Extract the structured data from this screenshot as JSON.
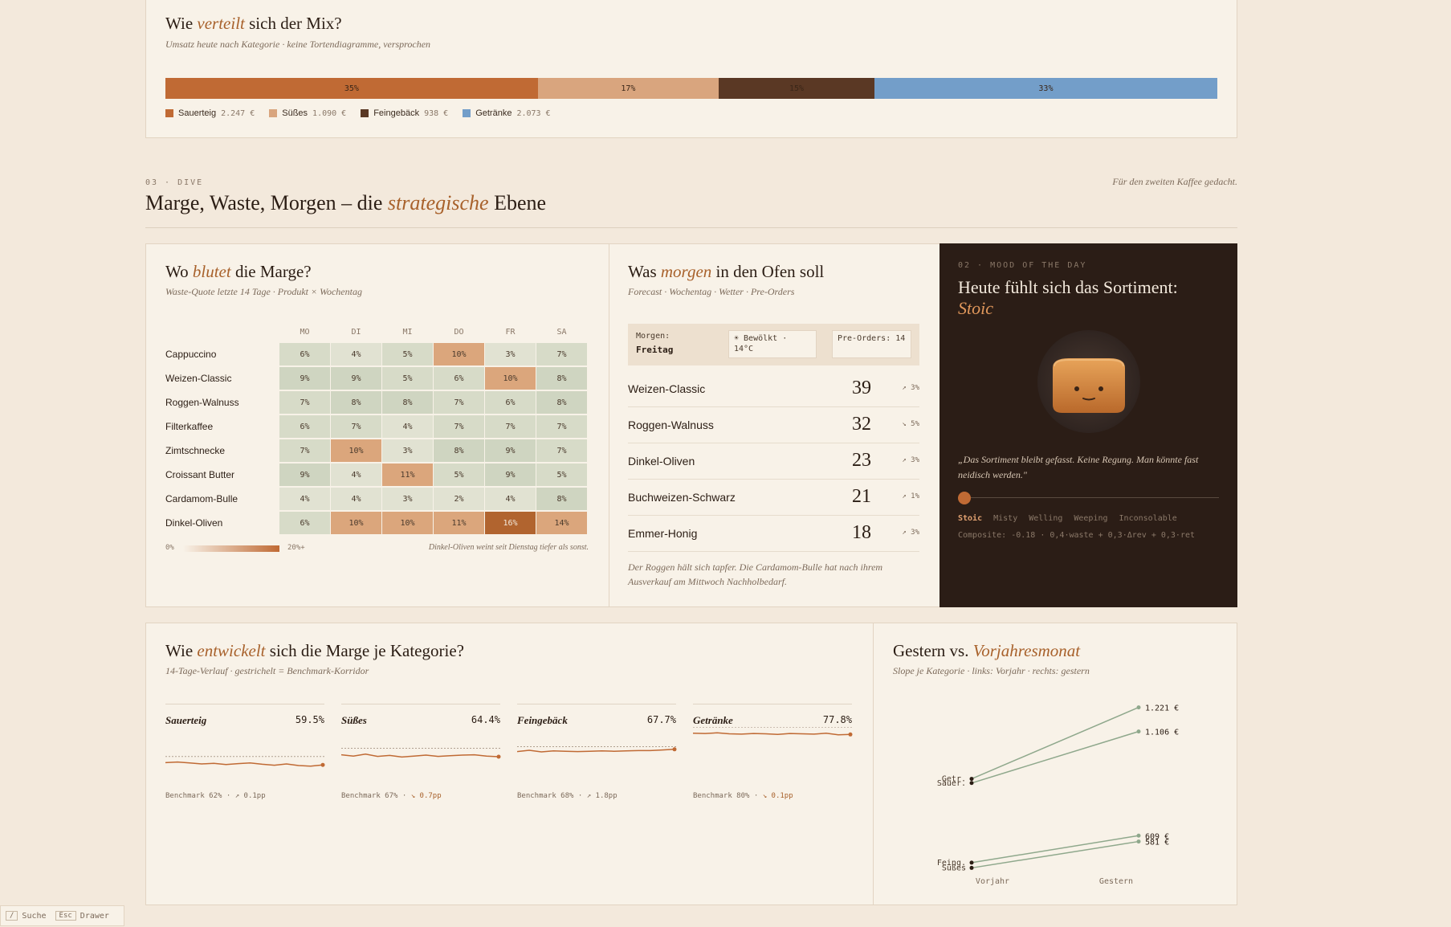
{
  "mix": {
    "title_pre": "Wie ",
    "title_em": "verteilt",
    "title_post": " sich der Mix?",
    "subtitle": "Umsatz heute nach Kategorie · keine Tortendiagramme, versprochen",
    "segments": [
      {
        "label": "35%",
        "share": 35.4,
        "color": "#c06a34"
      },
      {
        "label": "17%",
        "share": 17.2,
        "color": "#d9a57e"
      },
      {
        "label": "15%",
        "share": 14.8,
        "color": "#5a3824"
      },
      {
        "label": "33%",
        "share": 32.6,
        "color": "#739ec9"
      }
    ],
    "legend": [
      {
        "name": "Sauerteig",
        "value": "2.247 €",
        "color": "#c06a34"
      },
      {
        "name": "Süßes",
        "value": "1.090 €",
        "color": "#d9a57e"
      },
      {
        "name": "Feingebäck",
        "value": "938 €",
        "color": "#5a3824"
      },
      {
        "name": "Getränke",
        "value": "2.073 €",
        "color": "#739ec9"
      }
    ]
  },
  "section": {
    "eyebrow": "03 · DIVE",
    "title_pre": "Marge, Waste, Morgen – die ",
    "title_em": "strategische",
    "title_post": " Ebene",
    "aside": "Für den zweiten Kaffee gedacht."
  },
  "waste": {
    "title_pre": "Wo ",
    "title_em": "blutet",
    "title_post": " die Marge?",
    "subtitle": "Waste-Quote letzte 14 Tage · Produkt × Wochentag",
    "days": [
      "MO",
      "DI",
      "MI",
      "DO",
      "FR",
      "SA"
    ],
    "rows": [
      {
        "name": "Cappuccino",
        "values": [
          6,
          4,
          5,
          10,
          3,
          7
        ]
      },
      {
        "name": "Weizen-Classic",
        "values": [
          9,
          9,
          5,
          6,
          10,
          8
        ]
      },
      {
        "name": "Roggen-Walnuss",
        "values": [
          7,
          8,
          8,
          7,
          6,
          8
        ]
      },
      {
        "name": "Filterkaffee",
        "values": [
          6,
          7,
          4,
          7,
          7,
          7
        ]
      },
      {
        "name": "Zimtschnecke",
        "values": [
          7,
          10,
          3,
          8,
          9,
          7
        ]
      },
      {
        "name": "Croissant Butter",
        "values": [
          9,
          4,
          11,
          5,
          9,
          5
        ]
      },
      {
        "name": "Cardamom-Bulle",
        "values": [
          4,
          4,
          3,
          2,
          4,
          8
        ]
      },
      {
        "name": "Dinkel-Oliven",
        "values": [
          6,
          10,
          10,
          11,
          16,
          14
        ]
      }
    ],
    "scale_min": "0%",
    "scale_max": "20%+",
    "note": "Dinkel-Oliven weint seit Dienstag tiefer als sonst."
  },
  "forecast": {
    "title_pre": "Was ",
    "title_em": "morgen",
    "title_post": " in den Ofen soll",
    "subtitle": "Forecast · Wochentag · Wetter · Pre-Orders",
    "tomorrow_label": "Morgen:",
    "tomorrow_day": "Freitag",
    "weather": "☀ Bewölkt · 14°C",
    "preorders": "Pre-Orders: 14",
    "items": [
      {
        "name": "Weizen-Classic",
        "qty": "39",
        "trend": "↗ 3%"
      },
      {
        "name": "Roggen-Walnuss",
        "qty": "32",
        "trend": "↘ 5%"
      },
      {
        "name": "Dinkel-Oliven",
        "qty": "23",
        "trend": "↗ 3%"
      },
      {
        "name": "Buchweizen-Schwarz",
        "qty": "21",
        "trend": "↗ 1%"
      },
      {
        "name": "Emmer-Honig",
        "qty": "18",
        "trend": "↗ 3%"
      }
    ],
    "note": "Der Roggen hält sich tapfer. Die Cardamom-Bulle hat nach ihrem Ausverkauf am Mittwoch Nachholbedarf."
  },
  "mood": {
    "eyebrow": "02 · MOOD OF THE DAY",
    "title": "Heute fühlt sich das Sortiment:",
    "mood": "Stoic",
    "quote": "„Das Sortiment bleibt gefasst. Keine Regung. Man könnte fast neidisch werden.\"",
    "slider_level": 0.0,
    "scale": [
      "Stoic",
      "Misty",
      "Welling",
      "Weeping",
      "Inconsolable"
    ],
    "composite": "Composite: -0.18 · 0,4·waste + 0,3·Δrev + 0,3·ret"
  },
  "margin": {
    "title_pre": "Wie ",
    "title_em": "entwickelt",
    "title_post": " sich die Marge je Kategorie?",
    "subtitle": "14-Tage-Verlauf · gestrichelt = Benchmark-Korridor",
    "cats": [
      {
        "name": "Sauerteig",
        "value": "59.5%",
        "bench": "Benchmark 62% ·",
        "delta": "↗ 0.1pp",
        "dir": "up",
        "series": [
          60.2,
          60.4,
          60.1,
          59.8,
          60.0,
          59.6,
          59.9,
          60.1,
          59.7,
          59.4,
          59.8,
          59.3,
          59.1,
          59.5
        ],
        "benchmark": 62
      },
      {
        "name": "Süßes",
        "value": "64.4%",
        "bench": "Benchmark 67% ·",
        "delta": "↘ 0.7pp",
        "dir": "down",
        "series": [
          65.0,
          64.6,
          65.2,
          64.5,
          64.8,
          64.3,
          64.6,
          64.9,
          64.5,
          64.7,
          64.9,
          65.0,
          64.6,
          64.4
        ],
        "benchmark": 67
      },
      {
        "name": "Feingebäck",
        "value": "67.7%",
        "bench": "Benchmark 68% ·",
        "delta": "↗ 1.8pp",
        "dir": "up",
        "series": [
          67.0,
          67.4,
          66.9,
          67.2,
          67.1,
          67.0,
          67.1,
          67.2,
          67.1,
          67.2,
          67.3,
          67.3,
          67.5,
          67.7
        ],
        "benchmark": 68
      },
      {
        "name": "Getränke",
        "value": "77.8%",
        "bench": "Benchmark 80% ·",
        "delta": "↘ 0.1pp",
        "dir": "down",
        "series": [
          78.2,
          78.1,
          78.3,
          78.0,
          77.9,
          78.1,
          78.0,
          77.8,
          78.1,
          78.0,
          77.9,
          78.2,
          77.7,
          77.8
        ],
        "benchmark": 80
      }
    ]
  },
  "slope": {
    "title_pre": "Gestern vs. ",
    "title_em": "Vorjahresmonat",
    "subtitle": "Slope je Kategorie · links: Vorjahr · rechts: gestern",
    "left_axis": "Vorjahr",
    "right_axis": "Gestern",
    "chart_data": {
      "type": "line",
      "x": [
        "Vorjahr",
        "Gestern"
      ],
      "series": [
        {
          "name": "Getr.",
          "values": [
            880,
            1221
          ],
          "right_label": "1.221 €"
        },
        {
          "name": "Sauer.",
          "values": [
            860,
            1106
          ],
          "right_label": "1.106 €"
        },
        {
          "name": "Feing.",
          "values": [
            480,
            609
          ],
          "right_label": "609 €"
        },
        {
          "name": "Süßes",
          "values": [
            455,
            581
          ],
          "right_label": "581 €"
        }
      ],
      "ylim": [
        380,
        1300
      ]
    }
  },
  "footer": {
    "key1": "/",
    "label1": "Suche",
    "key2": "Esc",
    "label2": "Drawer"
  }
}
